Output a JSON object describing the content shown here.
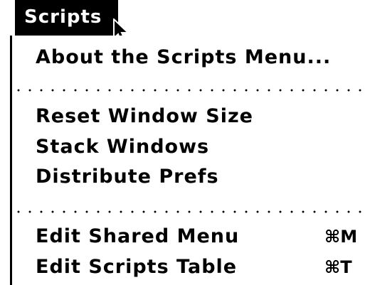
{
  "menu": {
    "title": "Scripts",
    "items": [
      {
        "label": "About the Scripts Menu..."
      },
      {
        "label": "Reset Window Size"
      },
      {
        "label": "Stack Windows"
      },
      {
        "label": "Distribute Prefs"
      },
      {
        "label": "Edit Shared Menu",
        "shortcut": "⌘M"
      },
      {
        "label": "Edit Scripts Table",
        "shortcut": "⌘T"
      }
    ]
  },
  "cursor": {
    "icon": "arrow-pointer-icon"
  },
  "colors": {
    "menu_bar_bg": "#000000",
    "menu_bar_fg": "#ffffff",
    "menu_bg": "#ffffff",
    "text": "#000000"
  }
}
